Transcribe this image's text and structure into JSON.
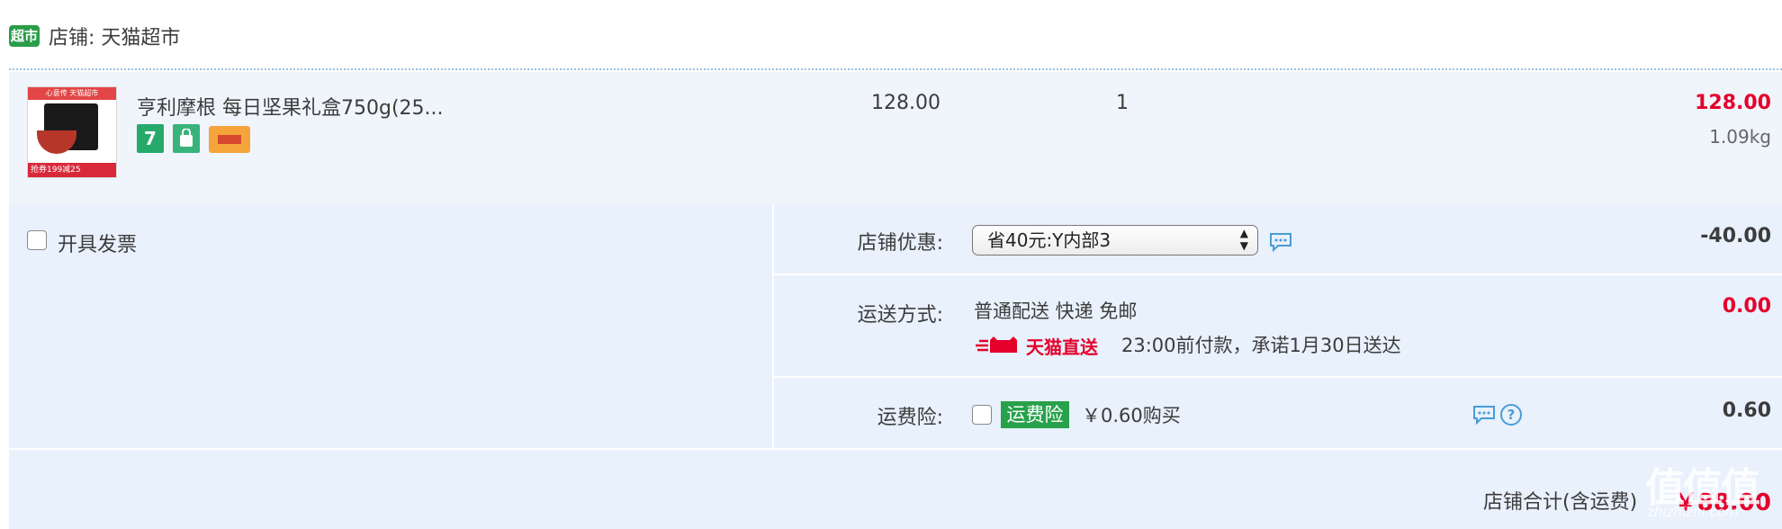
{
  "shop": {
    "logo_text": "超市",
    "label": "店铺: 天猫超市"
  },
  "item": {
    "thumb_top_text": "心意传 天猫超市",
    "thumb_bottom_text": "抢券199减25",
    "title": "亨利摩根 每日坚果礼盒750g(25...",
    "badge_7": "7",
    "unit_price": "128.00",
    "quantity": "1",
    "subtotal": "128.00",
    "weight": "1.09kg"
  },
  "invoice": {
    "label": "开具发票"
  },
  "discount": {
    "label": "店铺优惠:",
    "selected": "省40元:Y内部3",
    "value": "-40.00"
  },
  "shipping": {
    "label": "运送方式:",
    "method": "普通配送 快递 免邮",
    "tmall_tag": "天猫直送",
    "promise": "23:00前付款，承诺1月30日送达",
    "value": "0.00"
  },
  "insurance": {
    "label": "运费险:",
    "badge": "运费险",
    "price_text": "￥0.60购买",
    "value": "0.60"
  },
  "total": {
    "label": "店铺合计(含运费)",
    "value": "￥88.00"
  },
  "watermark": {
    "text": "值值值",
    "sub": "zhizhizhi.com"
  },
  "colors": {
    "accent_red": "#e4002b",
    "panel_bg": "#e8f1fc",
    "logo_green": "#2a9d49"
  }
}
